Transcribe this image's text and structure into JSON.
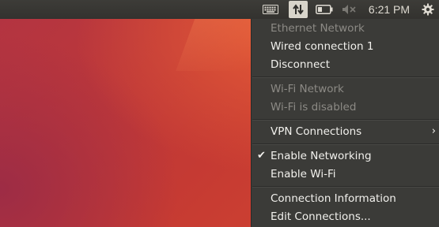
{
  "panel": {
    "indicators": [
      {
        "name": "keyboard-icon"
      },
      {
        "name": "network-icon"
      },
      {
        "name": "battery-icon"
      },
      {
        "name": "sound-muted-icon"
      },
      {
        "name": "power-gear-icon"
      }
    ],
    "clock": "6:21 PM"
  },
  "menu": {
    "ethernet_header": "Ethernet Network",
    "wired_connection": "Wired connection 1",
    "disconnect": "Disconnect",
    "wifi_header": "Wi-Fi Network",
    "wifi_disabled": "Wi-Fi is disabled",
    "vpn_connections": "VPN Connections",
    "vpn_arrow": "›",
    "enable_networking": "Enable Networking",
    "enable_networking_check": "✔",
    "enable_wifi": "Enable Wi-Fi",
    "connection_information": "Connection Information",
    "edit_connections": "Edit Connections..."
  },
  "colors": {
    "panel": "#3b3a36",
    "menu_bg": "#3b3b38",
    "menu_text": "#f2f1ed",
    "menu_disabled": "#8c8a85",
    "wallpaper": "#c23a31"
  }
}
